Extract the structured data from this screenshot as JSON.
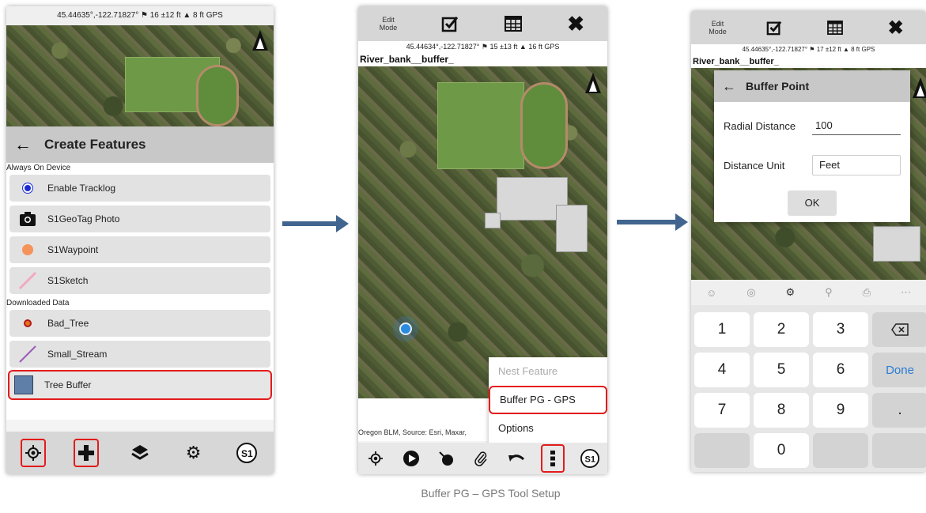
{
  "caption": "Buffer PG – GPS Tool Setup",
  "colors": {
    "highlight": "#e31b1b",
    "arrow": "#41658f"
  },
  "screen1": {
    "gps_status": "45.44635°,-122.71827° ⚑ 16 ±12 ft ▲ 8 ft GPS",
    "header_title": "Create Features",
    "sections": [
      {
        "label": "Always On Device",
        "items": [
          {
            "label": "Enable Tracklog",
            "icon": "blue-dot-icon"
          },
          {
            "label": "S1GeoTag Photo",
            "icon": "camera-icon"
          },
          {
            "label": "S1Waypoint",
            "icon": "orange-dot-icon"
          },
          {
            "label": "S1Sketch",
            "icon": "pink-line-icon"
          }
        ]
      },
      {
        "label": "Downloaded Data",
        "items": [
          {
            "label": "Bad_Tree",
            "icon": "red-dot-icon"
          },
          {
            "label": "Small_Stream",
            "icon": "purple-line-icon"
          },
          {
            "label": "Tree Buffer",
            "icon": "blue-square-icon"
          }
        ]
      }
    ],
    "toolbar": [
      "gps-icon",
      "add-icon",
      "layers-icon",
      "settings-icon",
      "s1-globe-icon"
    ]
  },
  "screen2": {
    "edit_mode": "Edit\nMode",
    "gps_status": "45.44634°,-122.71827° ⚑ 15 ±13 ft ▲ 16 ft GPS",
    "layer_name": "River_bank__buffer_",
    "attribution": "Oregon BLM, Source: Esri, Maxar,",
    "menu": {
      "nest": "Nest Feature",
      "buffer": "Buffer PG - GPS",
      "options": "Options"
    },
    "toolbar": [
      "gps-icon",
      "play-icon",
      "pin-icon",
      "clip-icon",
      "undo-icon",
      "more-icon",
      "s1-globe-icon"
    ]
  },
  "screen3": {
    "edit_mode": "Edit\nMode",
    "gps_status": "45.44635°,-122.71827° ⚑ 17 ±12 ft ▲ 8 ft GPS",
    "layer_name": "River_bank__buffer_",
    "dialog": {
      "title": "Buffer Point",
      "radial_label": "Radial Distance",
      "radial_value": "100",
      "unit_label": "Distance Unit",
      "unit_value": "Feet",
      "ok": "OK"
    },
    "keys": [
      "1",
      "2",
      "3",
      "4",
      "5",
      "6",
      "7",
      "8",
      "9",
      "0",
      "Done",
      "."
    ]
  }
}
